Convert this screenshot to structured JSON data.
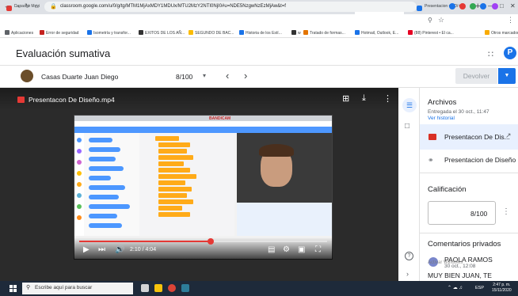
{
  "browser": {
    "tabs": [
      {
        "label": "Dapache Movi",
        "color": "#e53935"
      },
      {
        "label": "DIRECTORIO ESTUD",
        "color": "#0f9d58"
      },
      {
        "label": "COLEGIO DOMINIC",
        "color": "#1a73e8"
      },
      {
        "label": "Recibidos (1.477)",
        "color": "#d93025"
      },
      {
        "label": "(8) WhatsApp",
        "color": "#25d366"
      },
      {
        "label": "Evaluación sumativa",
        "color": "#1a73e8"
      },
      {
        "label": "Evaluación sumativa",
        "color": "#1a73e8"
      },
      {
        "label": "Presentacion de Di",
        "color": "#1a73e8"
      }
    ],
    "url": "classroom.google.com/u/0/g/tg/MTM1MjAxMDY1MDUx/MTU2MzY2NTI0NjI0#u=NDE5NzgwNzEzMjAw&t=f",
    "bookmarks": [
      {
        "label": "Aplicaciones",
        "color": "#5f6368"
      },
      {
        "label": "Error de seguridad",
        "color": "#c5221f"
      },
      {
        "label": "Isometría y transfor...",
        "color": "#1a73e8"
      },
      {
        "label": "EXITOS DE LOS AÑ...",
        "color": "#333333"
      },
      {
        "label": "SEGUNDO DE BAC...",
        "color": "#fbbc04"
      },
      {
        "label": "Historia de los Estí...",
        "color": "#1a73e8"
      },
      {
        "label": "w",
        "color": "#333333"
      },
      {
        "label": "Tratado de formas...",
        "color": "#e37400"
      },
      {
        "label": "Hotmail, Outlook, E...",
        "color": "#1a73e8"
      },
      {
        "label": "(88) Pinterest • El ca...",
        "color": "#e60023"
      },
      {
        "label": "Otros marcadores",
        "color": "#f9ab00"
      }
    ]
  },
  "classroom": {
    "title": "Evaluación sumativa",
    "avatar_letter": "P",
    "student_name": "Casas Duarte Juan Diego",
    "grade_top": "8/100",
    "return_label": "Devolver"
  },
  "viewer": {
    "file_title": "Presentacon De Diseño.mp4",
    "video": {
      "recorder_label": "BANDICAM",
      "time": "2:10 / 4:04",
      "progress": 0.53
    }
  },
  "panel": {
    "files_heading": "Archivos",
    "submitted_at": "Entregada el 30 oct., 11:47",
    "view_history": "Ver historial",
    "file_1": "Presentacon De Dis...",
    "file_2": "Presentacion de Diseño",
    "grade_heading": "Calificación",
    "grade_value": "8/100",
    "comments_heading": "Comentarios privados",
    "comment_author": "PAOLA RAMOS",
    "comment_time": "30 oct., 12:08",
    "comment_text": "MUY BIEN JUAN, TE QUIERES PRESENTAR CON TU PROYECTO",
    "activate_text": "Activar Windows"
  },
  "taskbar": {
    "search_placeholder": "Escribe aquí para buscar",
    "language": "ESP",
    "time": "2:47 p. m.",
    "date": "15/11/2020"
  }
}
